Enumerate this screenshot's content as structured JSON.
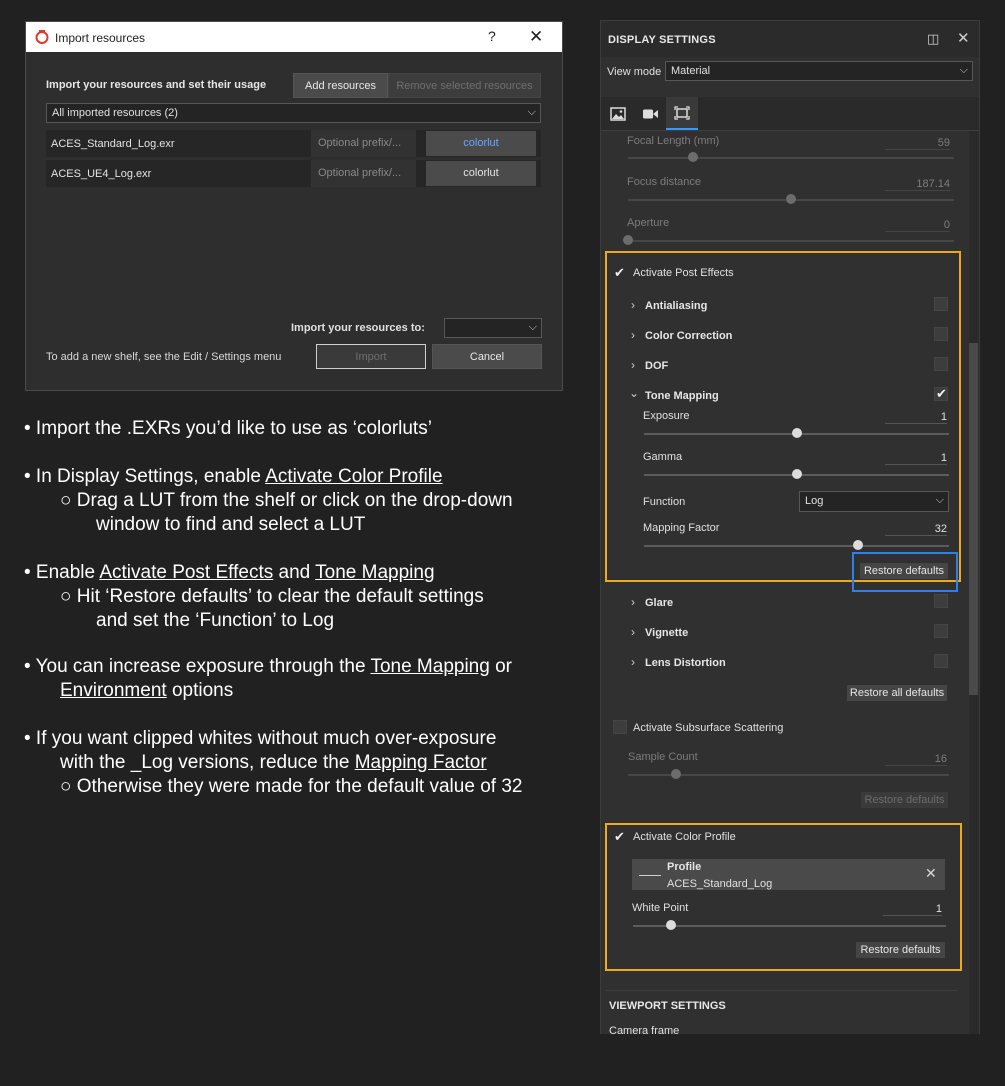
{
  "dialog": {
    "title": "Import resources",
    "help": "?",
    "close": "✕",
    "heading": "Import your resources and set their usage",
    "add_button": "Add resources",
    "remove_button": "Remove selected resources",
    "filter": "All imported resources (2)",
    "rows": [
      {
        "name": "ACES_Standard_Log.exr",
        "prefix_placeholder": "Optional prefix/...",
        "usage": "colorlut"
      },
      {
        "name": "ACES_UE4_Log.exr",
        "prefix_placeholder": "Optional prefix/...",
        "usage": "colorlut"
      }
    ],
    "import_to_label": "Import your resources to:",
    "import_to_value": "",
    "shelf_hint": "To add a new shelf, see the Edit / Settings menu",
    "import_button": "Import",
    "cancel_button": "Cancel"
  },
  "instructions": {
    "b1": "• Import the .EXRs you’d like to use as ‘colorluts’",
    "b2_pre": "• In Display Settings, enable ",
    "b2_link": "Activate Color Profile",
    "b2_sub_l1": "○ Drag a LUT from the shelf or click on the drop-down",
    "b2_sub_l2": "window to find and select a LUT",
    "b3_pre": "• Enable ",
    "b3_link1": "Activate Post Effects",
    "b3_mid": " and ",
    "b3_link2": "Tone Mapping",
    "b3_sub_l1": "○ Hit ‘Restore defaults’ to clear the default settings",
    "b3_sub_l2": "and set the ‘Function’ to Log",
    "b4_pre": "• You can increase exposure through the ",
    "b4_link1": "Tone Mapping",
    "b4_post": " or",
    "b4_link2": "Environment",
    "b4_post2": " options",
    "b5_l1": "• If you want clipped whites without much over-exposure",
    "b5_l2_pre": "with the _Log versions, reduce the ",
    "b5_l2_link": "Mapping Factor",
    "b5_sub": "○ Otherwise they were made for the default value of 32"
  },
  "panel": {
    "title": "DISPLAY SETTINGS",
    "viewmode_label": "View mode",
    "viewmode_value": "Material",
    "camera": {
      "focal_length_label": "Focal Length (mm)",
      "focal_length_value": "59",
      "focal_length_level": 0.2,
      "focus_distance_label": "Focus distance",
      "focus_distance_value": "187.14",
      "focus_distance_level": 0.5,
      "aperture_label": "Aperture",
      "aperture_value": "0",
      "aperture_level": 0.0
    },
    "post_effects": {
      "label": "Activate Post Effects",
      "antialiasing": "Antialiasing",
      "color_correction": "Color Correction",
      "dof": "DOF",
      "tone_mapping": "Tone Mapping",
      "exposure_label": "Exposure",
      "exposure_value": "1",
      "exposure_level": 0.5,
      "gamma_label": "Gamma",
      "gamma_value": "1",
      "gamma_level": 0.5,
      "function_label": "Function",
      "function_value": "Log",
      "mapping_label": "Mapping Factor",
      "mapping_value": "32",
      "mapping_level": 0.7,
      "restore": "Restore defaults",
      "glare": "Glare",
      "vignette": "Vignette",
      "lens_distortion": "Lens Distortion",
      "restore_all": "Restore all defaults"
    },
    "sss": {
      "label": "Activate Subsurface Scattering",
      "sample_label": "Sample Count",
      "sample_value": "16",
      "sample_level": 0.15,
      "restore": "Restore defaults"
    },
    "color_profile": {
      "label": "Activate Color Profile",
      "profile_title": "Profile",
      "profile_value": "ACES_Standard_Log",
      "white_point_label": "White Point",
      "white_point_value": "1",
      "white_point_level": 0.12,
      "restore": "Restore defaults"
    },
    "viewport": {
      "title": "VIEWPORT SETTINGS",
      "camera_frame": "Camera frame"
    }
  }
}
